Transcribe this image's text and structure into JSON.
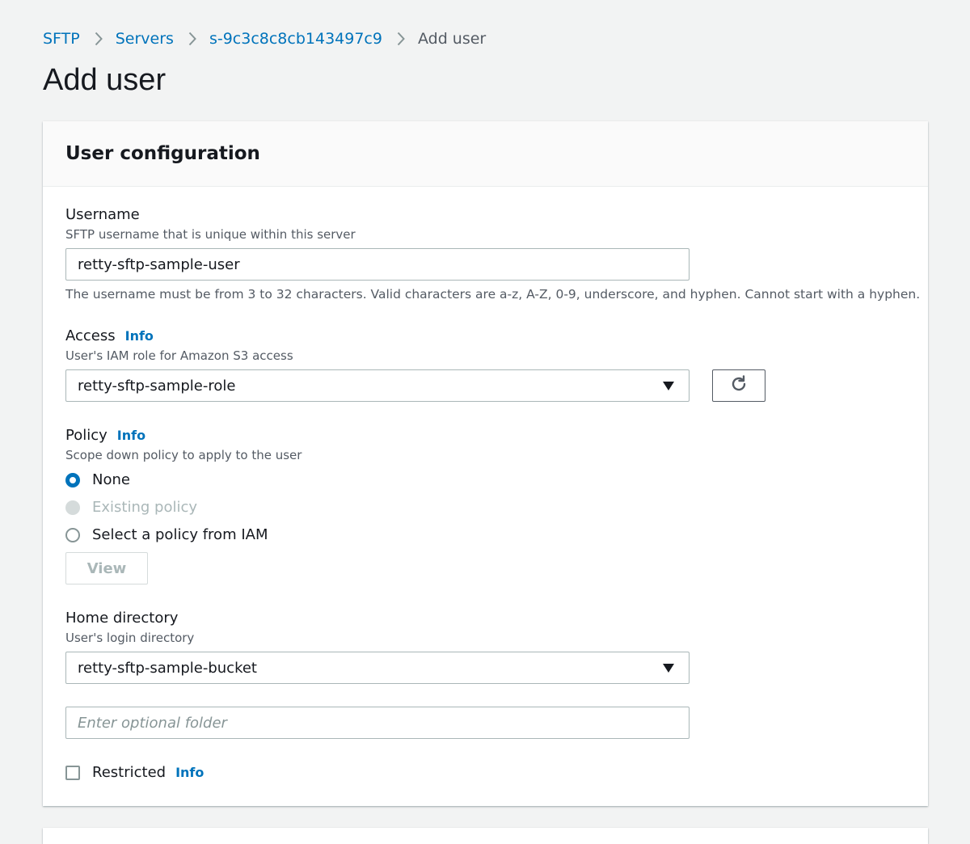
{
  "breadcrumb": {
    "items": [
      {
        "label": "SFTP"
      },
      {
        "label": "Servers"
      },
      {
        "label": "s-9c3c8c8cb143497c9"
      },
      {
        "label": "Add user"
      }
    ]
  },
  "page": {
    "title": "Add user"
  },
  "card": {
    "title": "User configuration",
    "username": {
      "label": "Username",
      "description": "SFTP username that is unique within this server",
      "value": "retty-sftp-sample-user",
      "hint": "The username must be from 3 to 32 characters. Valid characters are a-z, A-Z, 0-9, underscore, and hyphen. Cannot start with a hyphen."
    },
    "access": {
      "label": "Access",
      "info": "Info",
      "description": "User's IAM role for Amazon S3 access",
      "selected": "retty-sftp-sample-role"
    },
    "policy": {
      "label": "Policy",
      "info": "Info",
      "description": "Scope down policy to apply to the user",
      "options": [
        {
          "label": "None",
          "state": "checked"
        },
        {
          "label": "Existing policy",
          "state": "disabled"
        },
        {
          "label": "Select a policy from IAM",
          "state": "unchecked"
        }
      ],
      "view_label": "View"
    },
    "home": {
      "label": "Home directory",
      "description": "User's login directory",
      "selected": "retty-sftp-sample-bucket",
      "folder_placeholder": "Enter optional folder"
    },
    "restricted": {
      "label": "Restricted",
      "info": "Info",
      "checked": false
    }
  },
  "colors": {
    "link": "#0073bb",
    "background": "#f2f3f3",
    "text": "#16191f",
    "muted": "#545b64"
  }
}
